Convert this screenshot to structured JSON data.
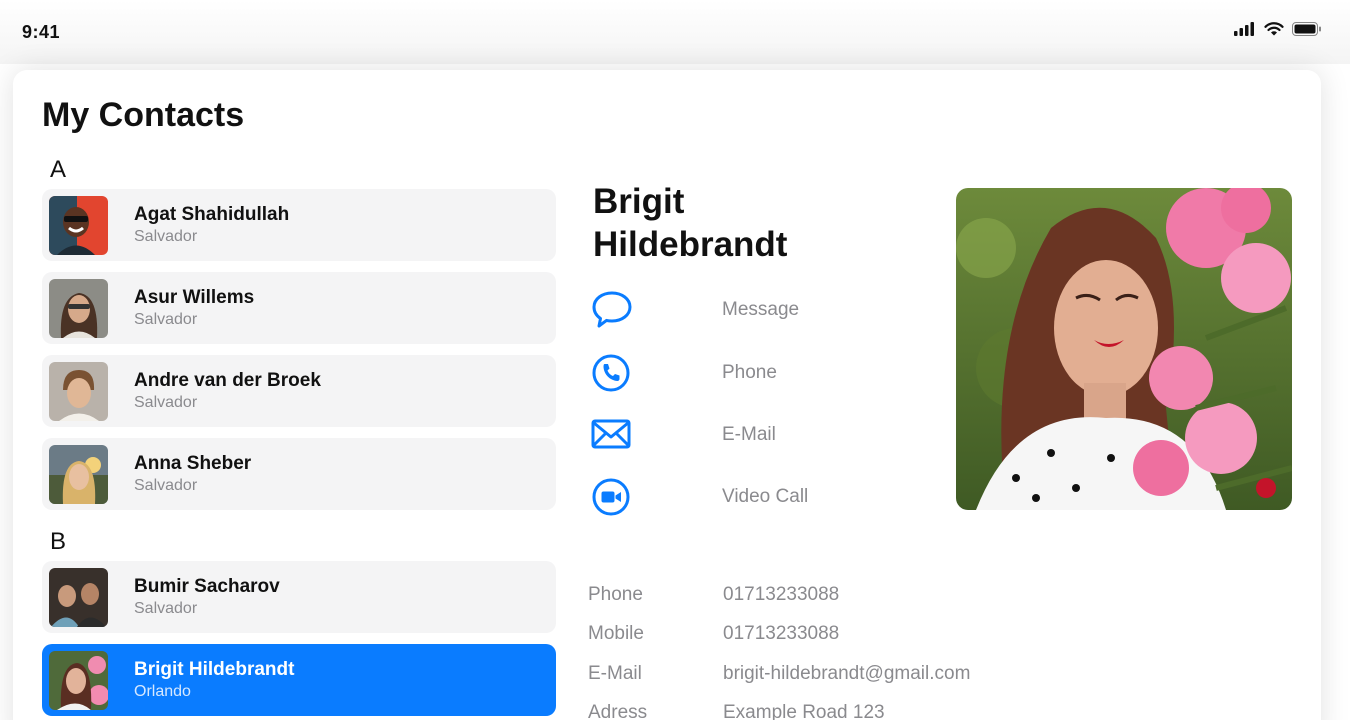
{
  "status": {
    "time": "9:41"
  },
  "page": {
    "title": "My Contacts"
  },
  "sections": [
    {
      "letter": "A"
    },
    {
      "letter": "B"
    }
  ],
  "contacts": [
    {
      "name": "Agat Shahidullah",
      "city": "Salvador"
    },
    {
      "name": "Asur Willems",
      "city": "Salvador"
    },
    {
      "name": "Andre van der Broek",
      "city": "Salvador"
    },
    {
      "name": "Anna Sheber",
      "city": "Salvador"
    },
    {
      "name": "Bumir Sacharov",
      "city": "Salvador"
    },
    {
      "name": "Brigit Hildebrandt",
      "city": "Orlando",
      "selected": true
    }
  ],
  "detail": {
    "name": "Brigit Hildebrandt",
    "actions": [
      {
        "label": "Message",
        "icon": "message-bubble-icon"
      },
      {
        "label": "Phone",
        "icon": "phone-icon"
      },
      {
        "label": "E-Mail",
        "icon": "mail-envelope-icon"
      },
      {
        "label": "Video Call",
        "icon": "video-camera-icon"
      }
    ],
    "info": [
      {
        "label": "Phone",
        "value": "01713233088"
      },
      {
        "label": "Mobile",
        "value": "01713233088"
      },
      {
        "label": "E-Mail",
        "value": "brigit-hildebrandt@gmail.com"
      },
      {
        "label": "Adress",
        "value": "Example Road 123"
      }
    ]
  },
  "colors": {
    "accent": "#0a7cff",
    "row_bg": "#f4f4f5",
    "muted_text": "#8a8a8e"
  }
}
